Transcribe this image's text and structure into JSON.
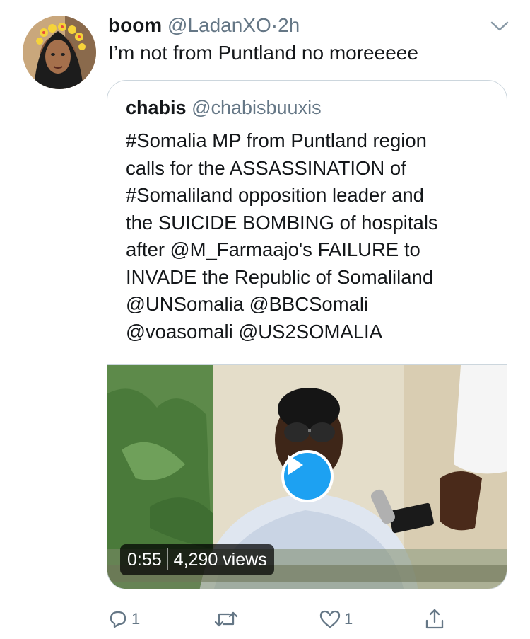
{
  "tweet": {
    "author_name": "boom",
    "author_handle": "@LadanXO",
    "separator": "·",
    "time": "2h",
    "text": "I’m not from Puntland no moreeeee"
  },
  "quoted_tweet": {
    "author_name": "chabis",
    "author_handle": "@chabisbuuxis",
    "text_lines": [
      "#Somalia MP from Puntland region",
      "calls for the ASSASSINATION of",
      "#Somaliland opposition leader and",
      "the SUICIDE BOMBING of hospitals",
      "after @M_Farmaajo's FAILURE to",
      "INVADE the Republic of Somaliland",
      "@UNSomalia @BBCSomali",
      "@voasomali @US2SOMALIA"
    ],
    "video": {
      "duration": "0:55",
      "views": "4,290 views"
    }
  },
  "actions": {
    "reply_count": "1",
    "retweet_count": "",
    "like_count": "1"
  },
  "icons": {
    "reply": "reply-icon",
    "retweet": "retweet-icon",
    "like": "heart-icon",
    "share": "share-icon",
    "play": "play-icon",
    "menu": "chevron-down-icon"
  },
  "colors": {
    "accent": "#1da1f2",
    "secondary_text": "#657786",
    "border": "#ccd6dd"
  }
}
